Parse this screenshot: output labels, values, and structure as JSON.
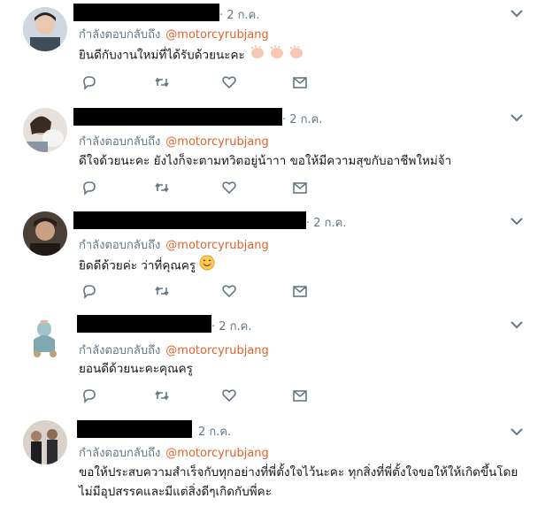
{
  "tweets": [
    {
      "time": "· 2 ก.ค.",
      "reply_prefix": "กำลังตอบกลับถึง",
      "handle": "@motorcyrubjang",
      "text": "ยินดีกับงานใหม่ที่ได้รับด้วยนะคะ",
      "emoji": "clapping-hands-icon"
    },
    {
      "time": "· 2 ก.ค.",
      "reply_prefix": "กำลังตอบกลับถึง",
      "handle": "@motorcyrubjang",
      "text": "ดีใจด้วยนะคะ ยังไงก็จะตามทวิตอยู่น้าาา ขอให้มีความสุขกับอาชีพใหม่จ้า"
    },
    {
      "time": "· 2 ก.ค.",
      "reply_prefix": "กำลังตอบกลับถึง",
      "handle": "@motorcyrubjang",
      "text": "ยิดดีด้วยค่ะ ว่าที่คุณครู",
      "emoji": "smiling-face-icon"
    },
    {
      "time": "· 2 ก.ค.",
      "reply_prefix": "กำลังตอบกลับถึง",
      "handle": "@motorcyrubjang",
      "text": "ยอนดีด้วยนะคะคุณครู"
    },
    {
      "time": "2 ก.ค.",
      "reply_prefix": "กำลังตอบกลับถึง",
      "handle": "@motorcyrubjang",
      "text": "ขอให้ประสบความสำเร็จกับทุกอย่างที่พี่ตั้งใจไว้นะคะ ทุกสิ่งที่พี่ตั้งใจขอให้ให้เกิดขึ้นโดยไม่มีอุปสรรคและมีแต่สิ่งดีๆเกิดกับพี่คะ"
    }
  ],
  "colors": {
    "handle": "#e0632b",
    "meta": "#657786",
    "icon": "#657786",
    "divider": "#e6ecf0"
  }
}
